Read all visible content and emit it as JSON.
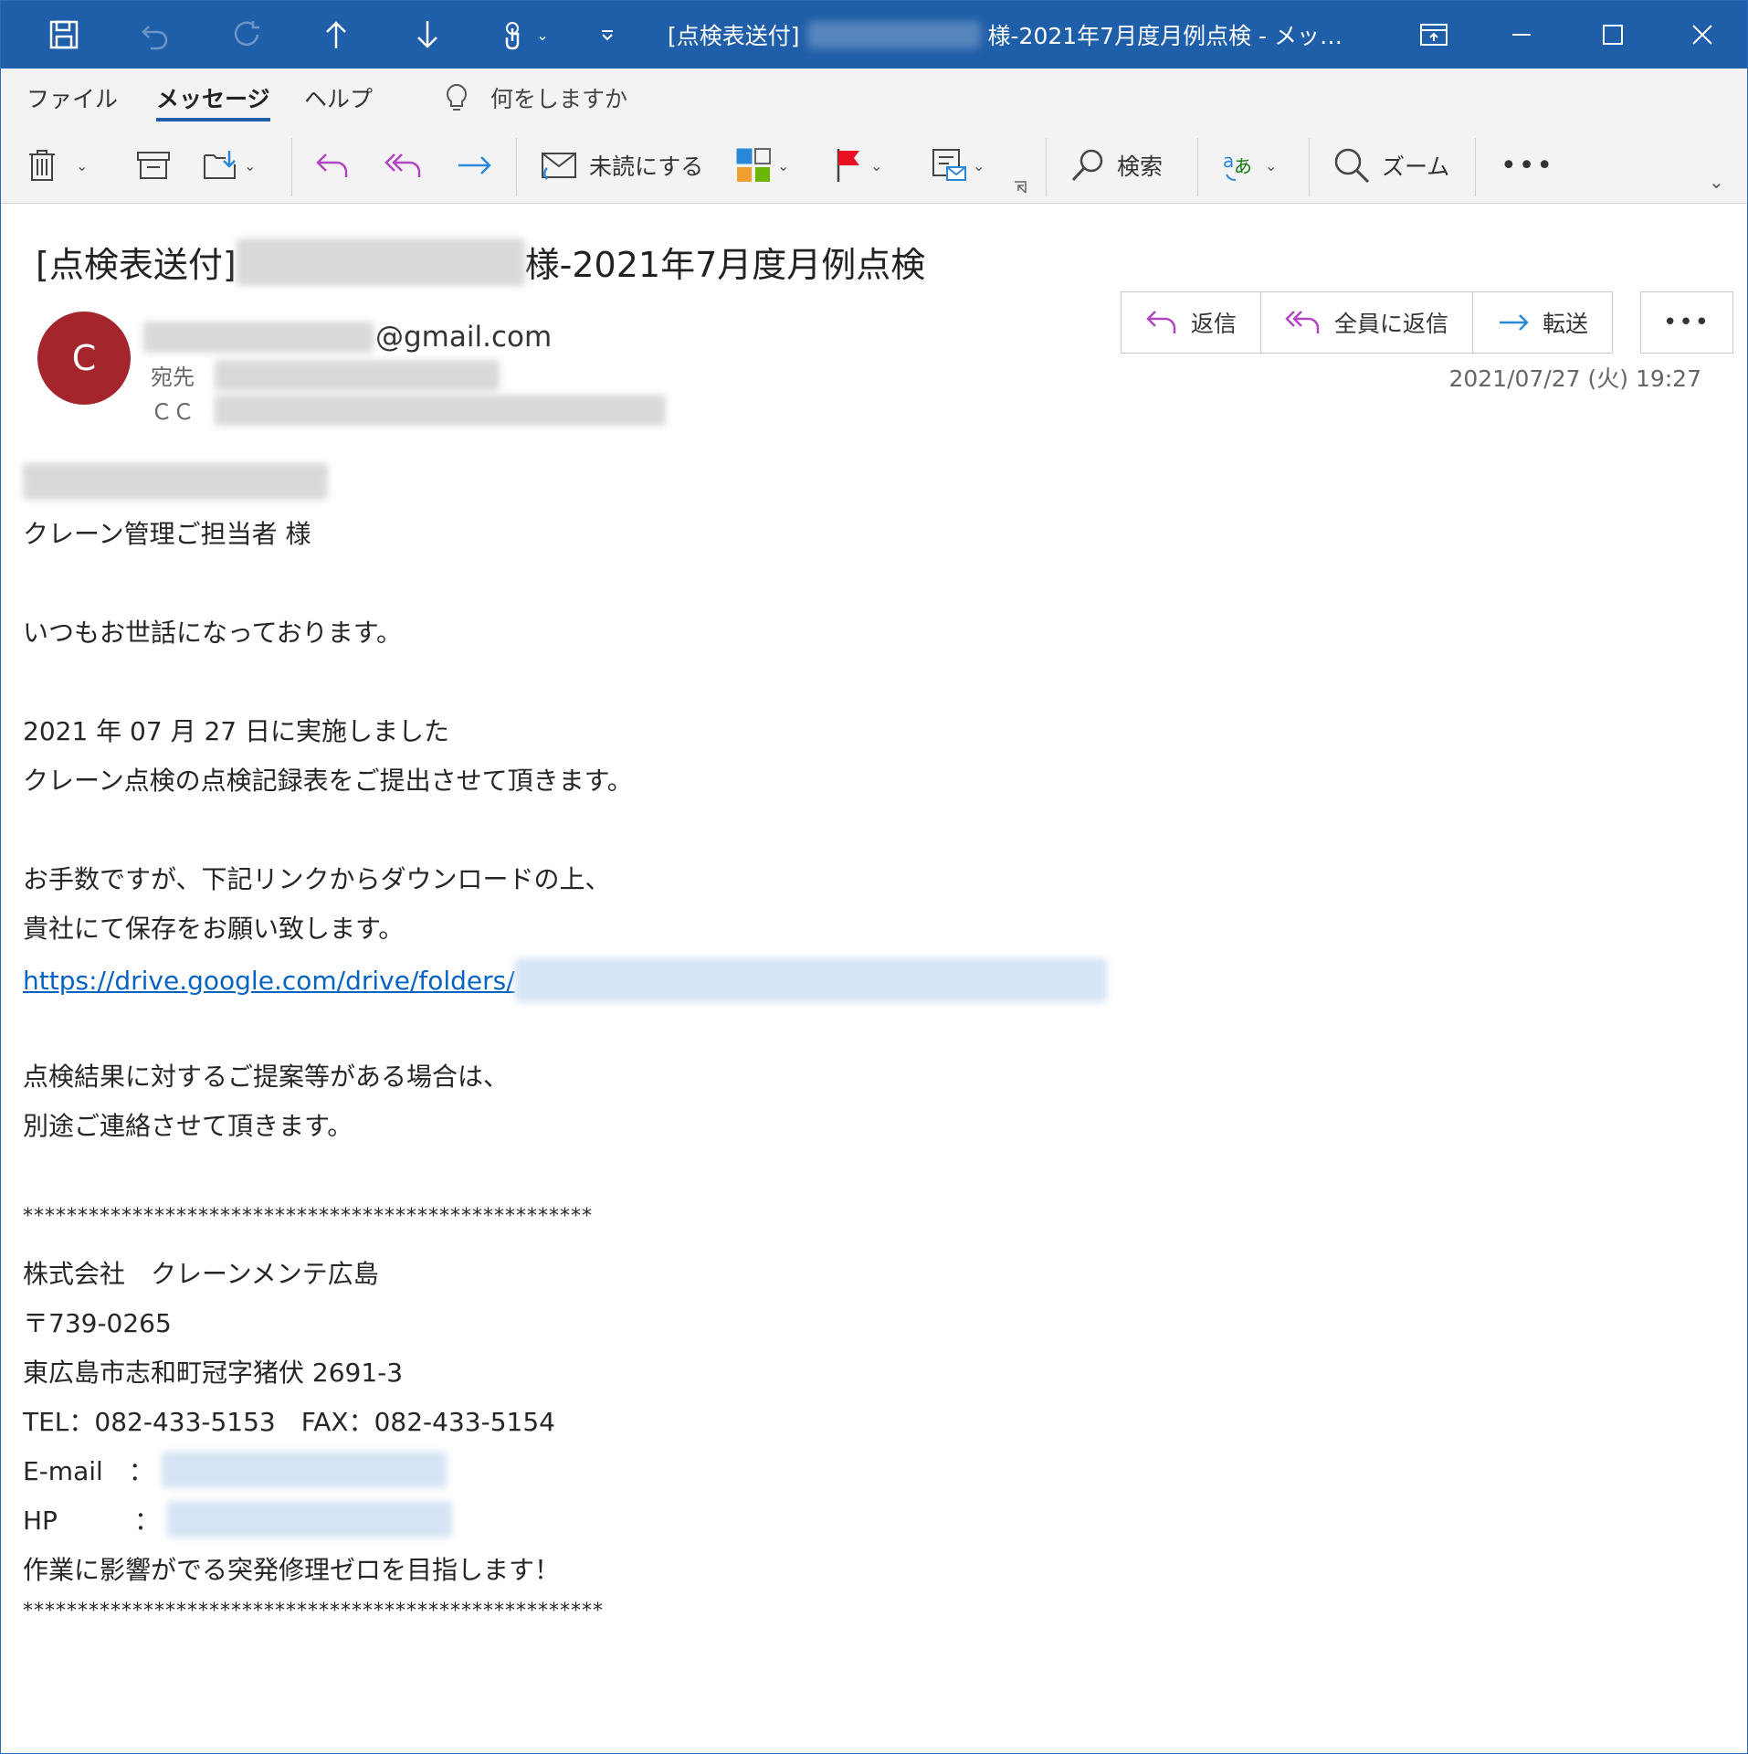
{
  "window": {
    "title_prefix": "[点検表送付]",
    "title_suffix": "様-2021年7月度月例点検 - メッ…"
  },
  "menu": {
    "tabs": [
      "ファイル",
      "メッセージ",
      "ヘルプ"
    ],
    "active_tab": "メッセージ",
    "tell_me": "何をしますか"
  },
  "ribbon": {
    "mark_unread": "未読にする",
    "search": "検索",
    "zoom": "ズーム"
  },
  "message": {
    "subject_prefix": "[点検表送付]",
    "subject_suffix": "様-2021年7月度月例点検",
    "avatar_initial": "C",
    "sender_domain": "@gmail.com",
    "to_label": "宛先",
    "cc_label": "ＣＣ",
    "date": "2021/07/27 (火) 19:27",
    "actions": {
      "reply": "返信",
      "reply_all": "全員に返信",
      "forward": "転送"
    }
  },
  "body": {
    "salutation": "クレーン管理ご担当者 様",
    "greeting": "いつもお世話になっております。",
    "line1": "2021 年 07 月 27 日に実施しました",
    "line2": "クレーン点検の点検記録表をご提出させて頂きます。",
    "line3": "お手数ですが、下記リンクからダウンロードの上、",
    "line4": "貴社にて保存をお願い致します。",
    "link_prefix": "https://drive.google.com/drive/folders/",
    "line5": "点検結果に対するご提案等がある場合は、",
    "line6": "別途ご連絡させて頂きます。",
    "stars_top": "****************************************************",
    "company": "株式会社　クレーンメンテ広島",
    "postal": "〒739-0265",
    "address": "東広島市志和町冠字猪伏 2691-3",
    "tel_fax": "TEL：082-433-5153　FAX：082-433-5154",
    "email_label": "E-mail　：",
    "hp_label": "HP　　　：",
    "slogan": "作業に影響がでる突発修理ゼロを目指します！",
    "stars_bottom": "*****************************************************"
  },
  "colors": {
    "titlebar": "#1f5ea8",
    "avatar": "#a4262c",
    "reply_icon": "#b146c2",
    "forward_icon": "#2b88d8",
    "link": "#0563c1"
  }
}
